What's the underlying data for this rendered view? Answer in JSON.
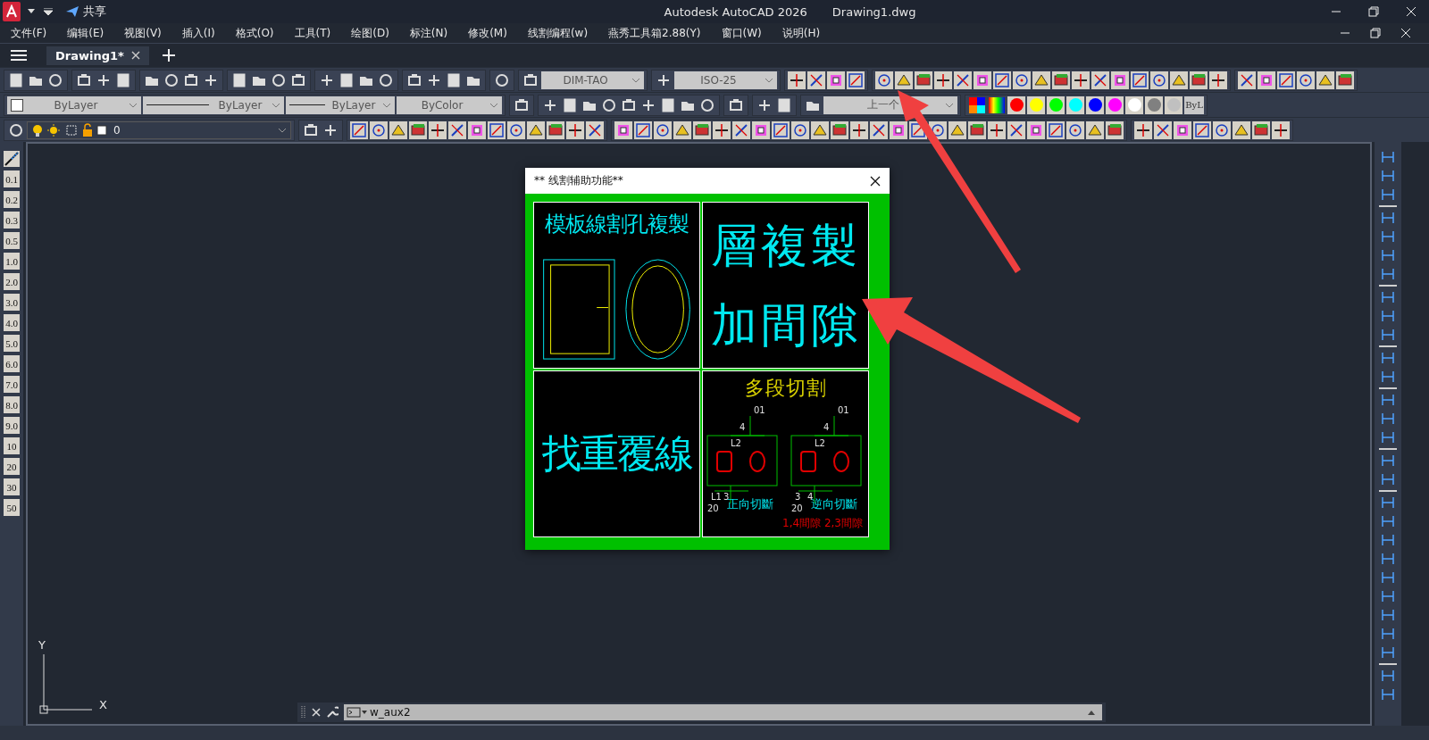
{
  "window": {
    "share_label": "共享",
    "title": "Autodesk AutoCAD 2026",
    "document": "Drawing1.dwg"
  },
  "menu": [
    "文件(F)",
    "编辑(E)",
    "视图(V)",
    "插入(I)",
    "格式(O)",
    "工具(T)",
    "绘图(D)",
    "标注(N)",
    "修改(M)",
    "线割编程(w)",
    "燕秀工具箱2.88(Y)",
    "窗口(W)",
    "说明(H)"
  ],
  "tabs": [
    {
      "label": "Drawing1*",
      "selected": true
    }
  ],
  "toolbar": {
    "text_style": "DIM-TAO",
    "dim_style": "ISO-25",
    "color_control": "ByLayer",
    "linetype": "ByLayer",
    "lineweight": "ByLayer",
    "plot_style": "ByColor",
    "view": "上一个",
    "bylayer_button": "ByL",
    "layer": "0"
  },
  "color_swatches": [
    {
      "color": "#ff0000"
    },
    {
      "color": "#ffff00"
    },
    {
      "color": "#00ff00"
    },
    {
      "color": "#00ffff"
    },
    {
      "color": "#0000ff"
    },
    {
      "color": "#ff00ff"
    },
    {
      "color": "#ffffff"
    },
    {
      "color": "#808080"
    },
    {
      "color": "#c0c0c0"
    }
  ],
  "lineweight_buttons": [
    "0.1",
    "0.2",
    "0.3",
    "0.5",
    "1.0",
    "2.0",
    "3.0",
    "4.0",
    "5.0",
    "6.0",
    "7.0",
    "8.0",
    "9.0",
    "10",
    "20",
    "30",
    "50"
  ],
  "dialog": {
    "title": "**  线割辅助功能**",
    "panels": [
      {
        "kind": "template",
        "title": "模板線割孔複製"
      },
      {
        "kind": "layer",
        "lines": [
          "層複製",
          "加間隙"
        ]
      },
      {
        "kind": "overlap",
        "title": "找重覆線"
      },
      {
        "kind": "multi",
        "title": "多段切割",
        "left_labels": [
          "01",
          "4",
          "L2",
          "L1",
          "3",
          "20"
        ],
        "right_labels": [
          "01",
          "4",
          "L2",
          "3",
          "4",
          "20"
        ],
        "captions": [
          "正向切斷",
          "逆向切斷"
        ],
        "note": "1,4間隙 2,3間隙"
      }
    ]
  },
  "ucs": {
    "x_label": "X",
    "y_label": "Y"
  },
  "command_line": {
    "value": "w_aux2"
  }
}
